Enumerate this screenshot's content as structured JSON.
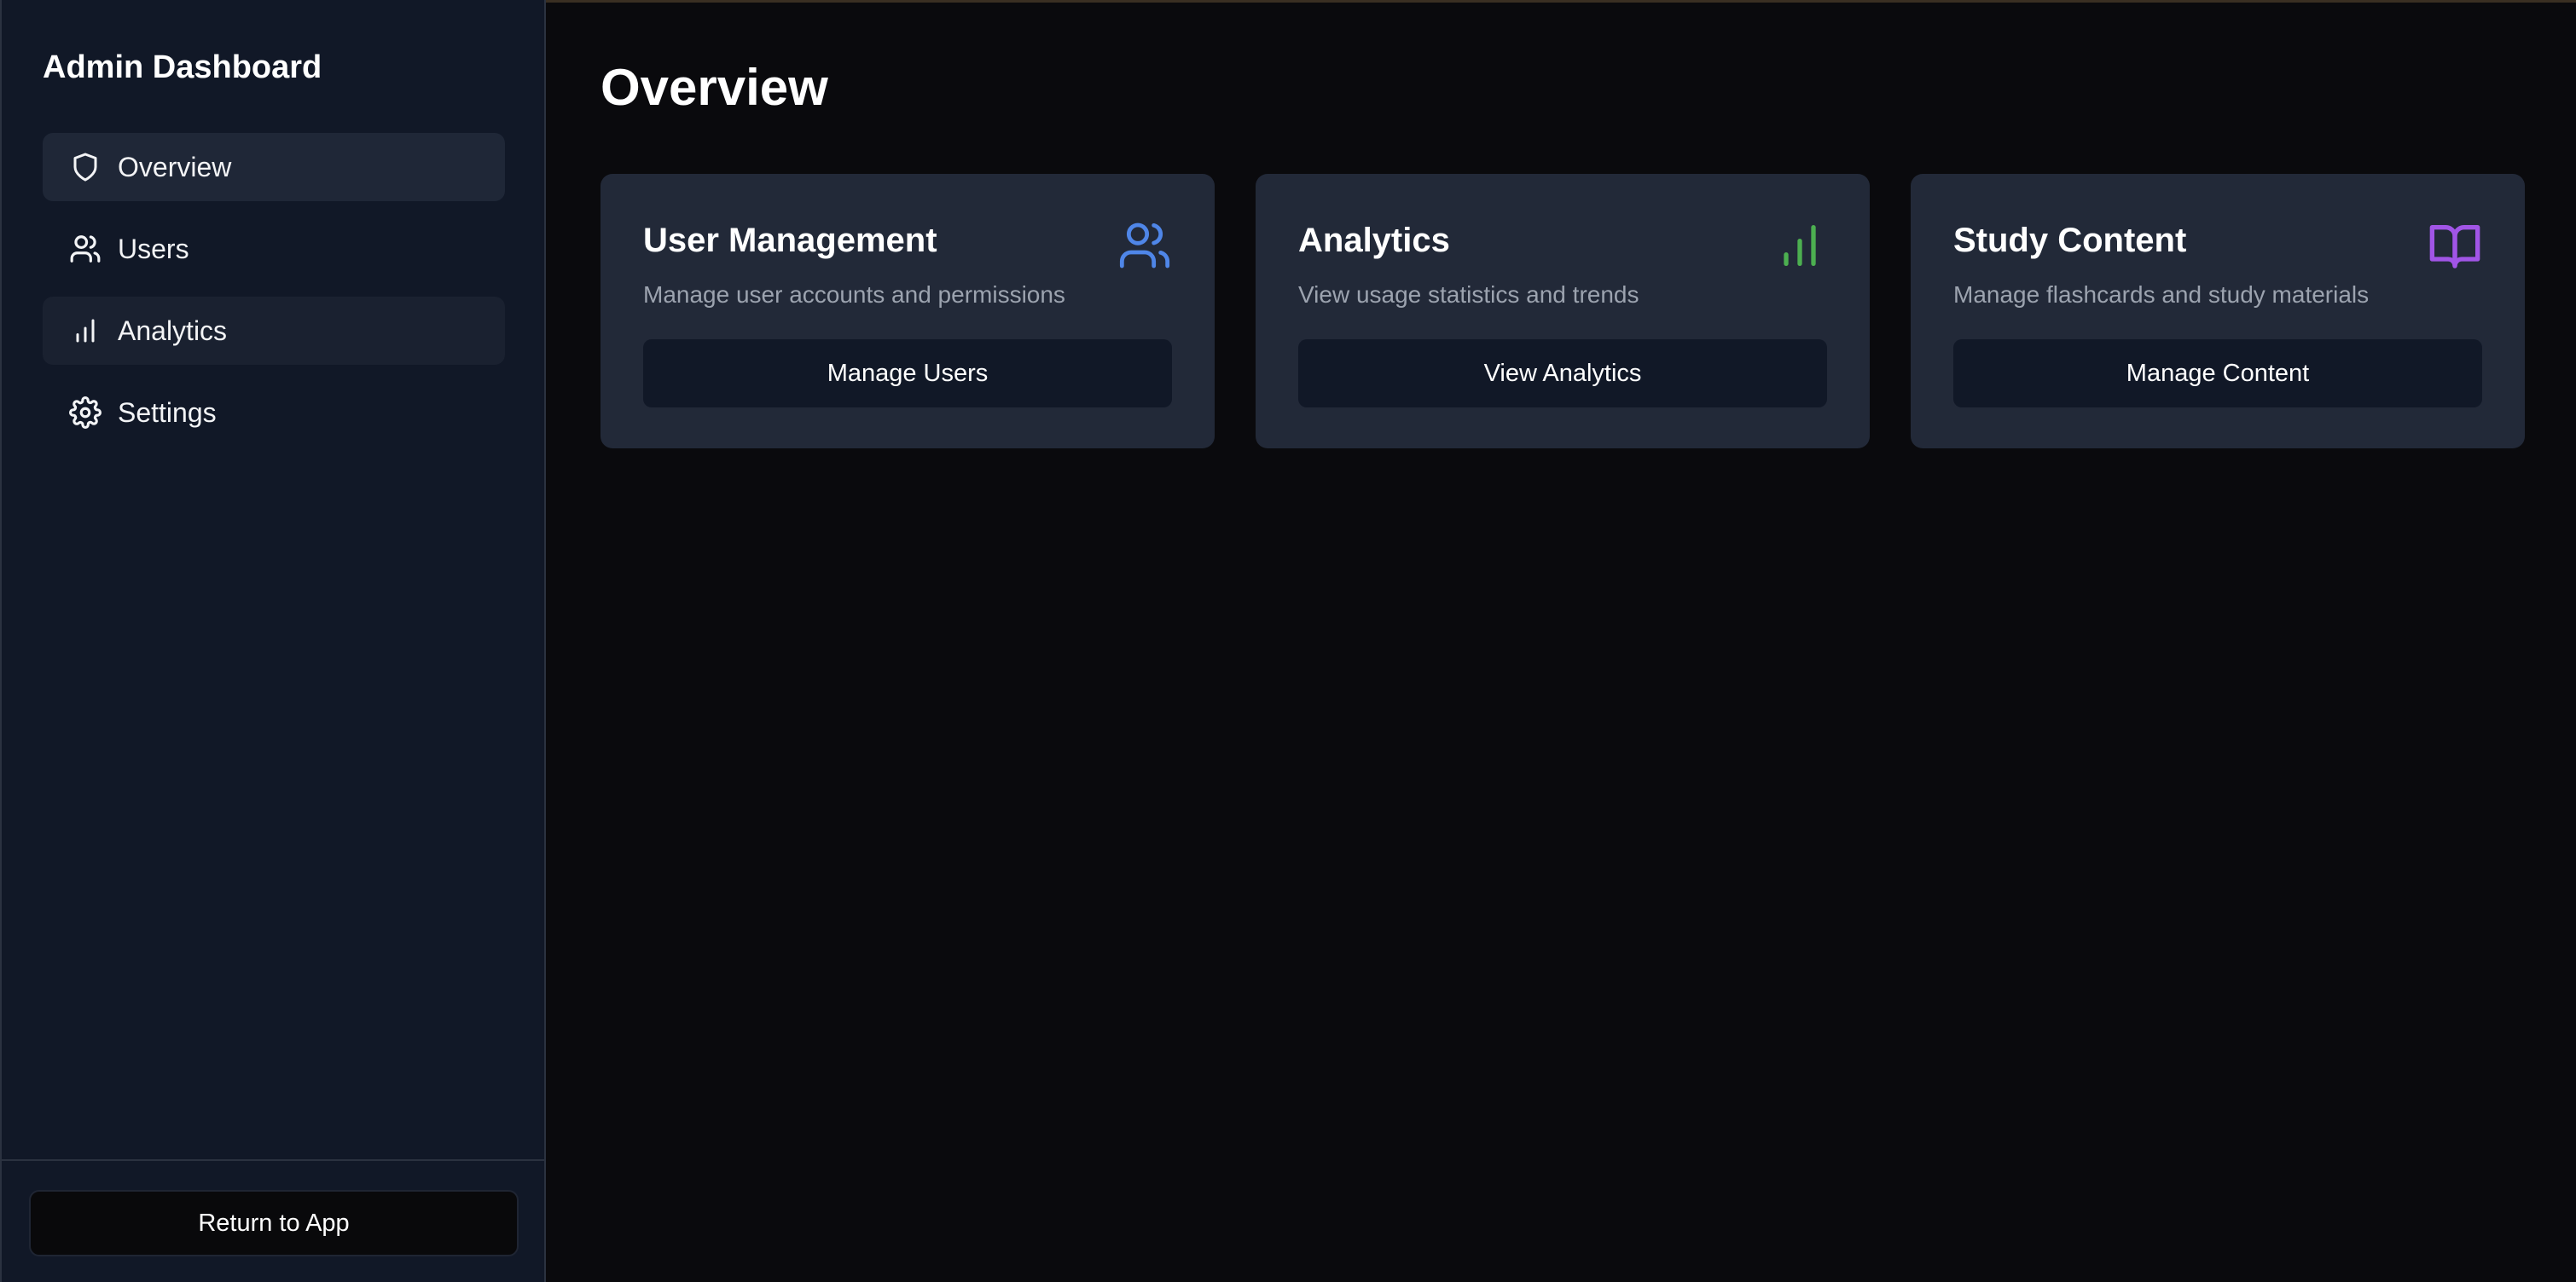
{
  "sidebar": {
    "title": "Admin Dashboard",
    "items": [
      {
        "label": "Overview",
        "icon": "shield-icon"
      },
      {
        "label": "Users",
        "icon": "users-icon"
      },
      {
        "label": "Analytics",
        "icon": "bar-chart-icon"
      },
      {
        "label": "Settings",
        "icon": "gear-icon"
      }
    ],
    "return_label": "Return to App"
  },
  "main": {
    "title": "Overview",
    "cards": [
      {
        "title": "User Management",
        "description": "Manage user accounts and permissions",
        "button": "Manage Users",
        "icon": "users-icon",
        "icon_color": "#4f86e8"
      },
      {
        "title": "Analytics",
        "description": "View usage statistics and trends",
        "button": "View Analytics",
        "icon": "bar-chart-icon",
        "icon_color": "#4caf50"
      },
      {
        "title": "Study Content",
        "description": "Manage flashcards and study materials",
        "button": "Manage Content",
        "icon": "book-open-icon",
        "icon_color": "#a155e6"
      }
    ]
  }
}
